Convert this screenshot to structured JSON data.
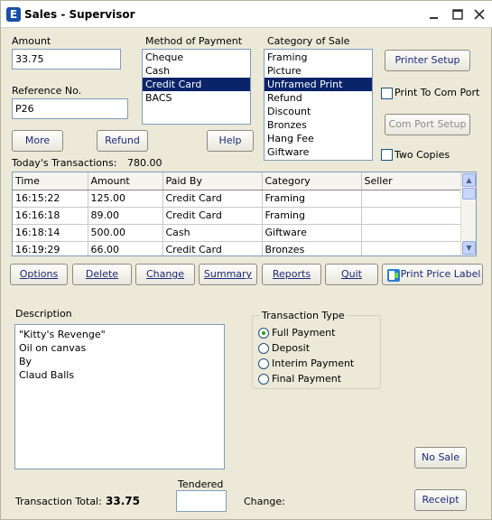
{
  "window": {
    "title": "Sales - Supervisor",
    "app_icon_glyph": "E"
  },
  "amount": {
    "label": "Amount",
    "value": "33.75"
  },
  "reference": {
    "label": "Reference No.",
    "value": "P26"
  },
  "payment": {
    "label": "Method of Payment",
    "options": [
      "Cheque",
      "Cash",
      "Credit Card",
      "BACS"
    ],
    "selected": "Credit Card"
  },
  "category": {
    "label": "Category of Sale",
    "options": [
      "Framing",
      "Picture",
      "Unframed Print",
      "Refund",
      "Discount",
      "Bronzes",
      "Hang Fee",
      "Giftware"
    ],
    "selected": "Unframed Print"
  },
  "buttons": {
    "printer_setup": "Printer Setup",
    "com_port_setup": "Com Port Setup",
    "more": "More",
    "refund": "Refund",
    "help": "Help",
    "options": "Options",
    "delete": "Delete",
    "change": "Change",
    "summary": "Summary",
    "reports": "Reports",
    "quit": "Quit",
    "print_price_label": "Print Price Label",
    "no_sale": "No Sale",
    "receipt": "Receipt"
  },
  "checkboxes": {
    "print_to_com_port": "Print To Com Port",
    "two_copies": "Two Copies"
  },
  "transactions": {
    "label": "Today's Transactions:",
    "total": "780.00",
    "columns": [
      "Time",
      "Amount",
      "Paid By",
      "Category",
      "Seller"
    ],
    "rows": [
      [
        "16:15:22",
        "125.00",
        "Credit Card",
        "Framing",
        ""
      ],
      [
        "16:16:18",
        "89.00",
        "Credit Card",
        "Framing",
        ""
      ],
      [
        "16:18:14",
        "500.00",
        "Cash",
        "Giftware",
        ""
      ],
      [
        "16:19:29",
        "66.00",
        "Credit Card",
        "Bronzes",
        ""
      ]
    ]
  },
  "description": {
    "label": "Description",
    "lines": [
      "\"Kitty's Revenge\"",
      "Oil on canvas",
      "By",
      "Claud Balls"
    ]
  },
  "transaction_type": {
    "label": "Transaction Type",
    "options": [
      "Full Payment",
      "Deposit",
      "Interim Payment",
      "Final Payment"
    ],
    "selected": "Full Payment"
  },
  "footer": {
    "total_label": "Transaction Total:",
    "total_value": "33.75",
    "tendered_label": "Tendered",
    "tendered_value": "",
    "change_label": "Change:"
  },
  "colors": {
    "selection": "#0a246a",
    "window_bg": "#ece9d8",
    "button_text": "#1c2a78"
  }
}
